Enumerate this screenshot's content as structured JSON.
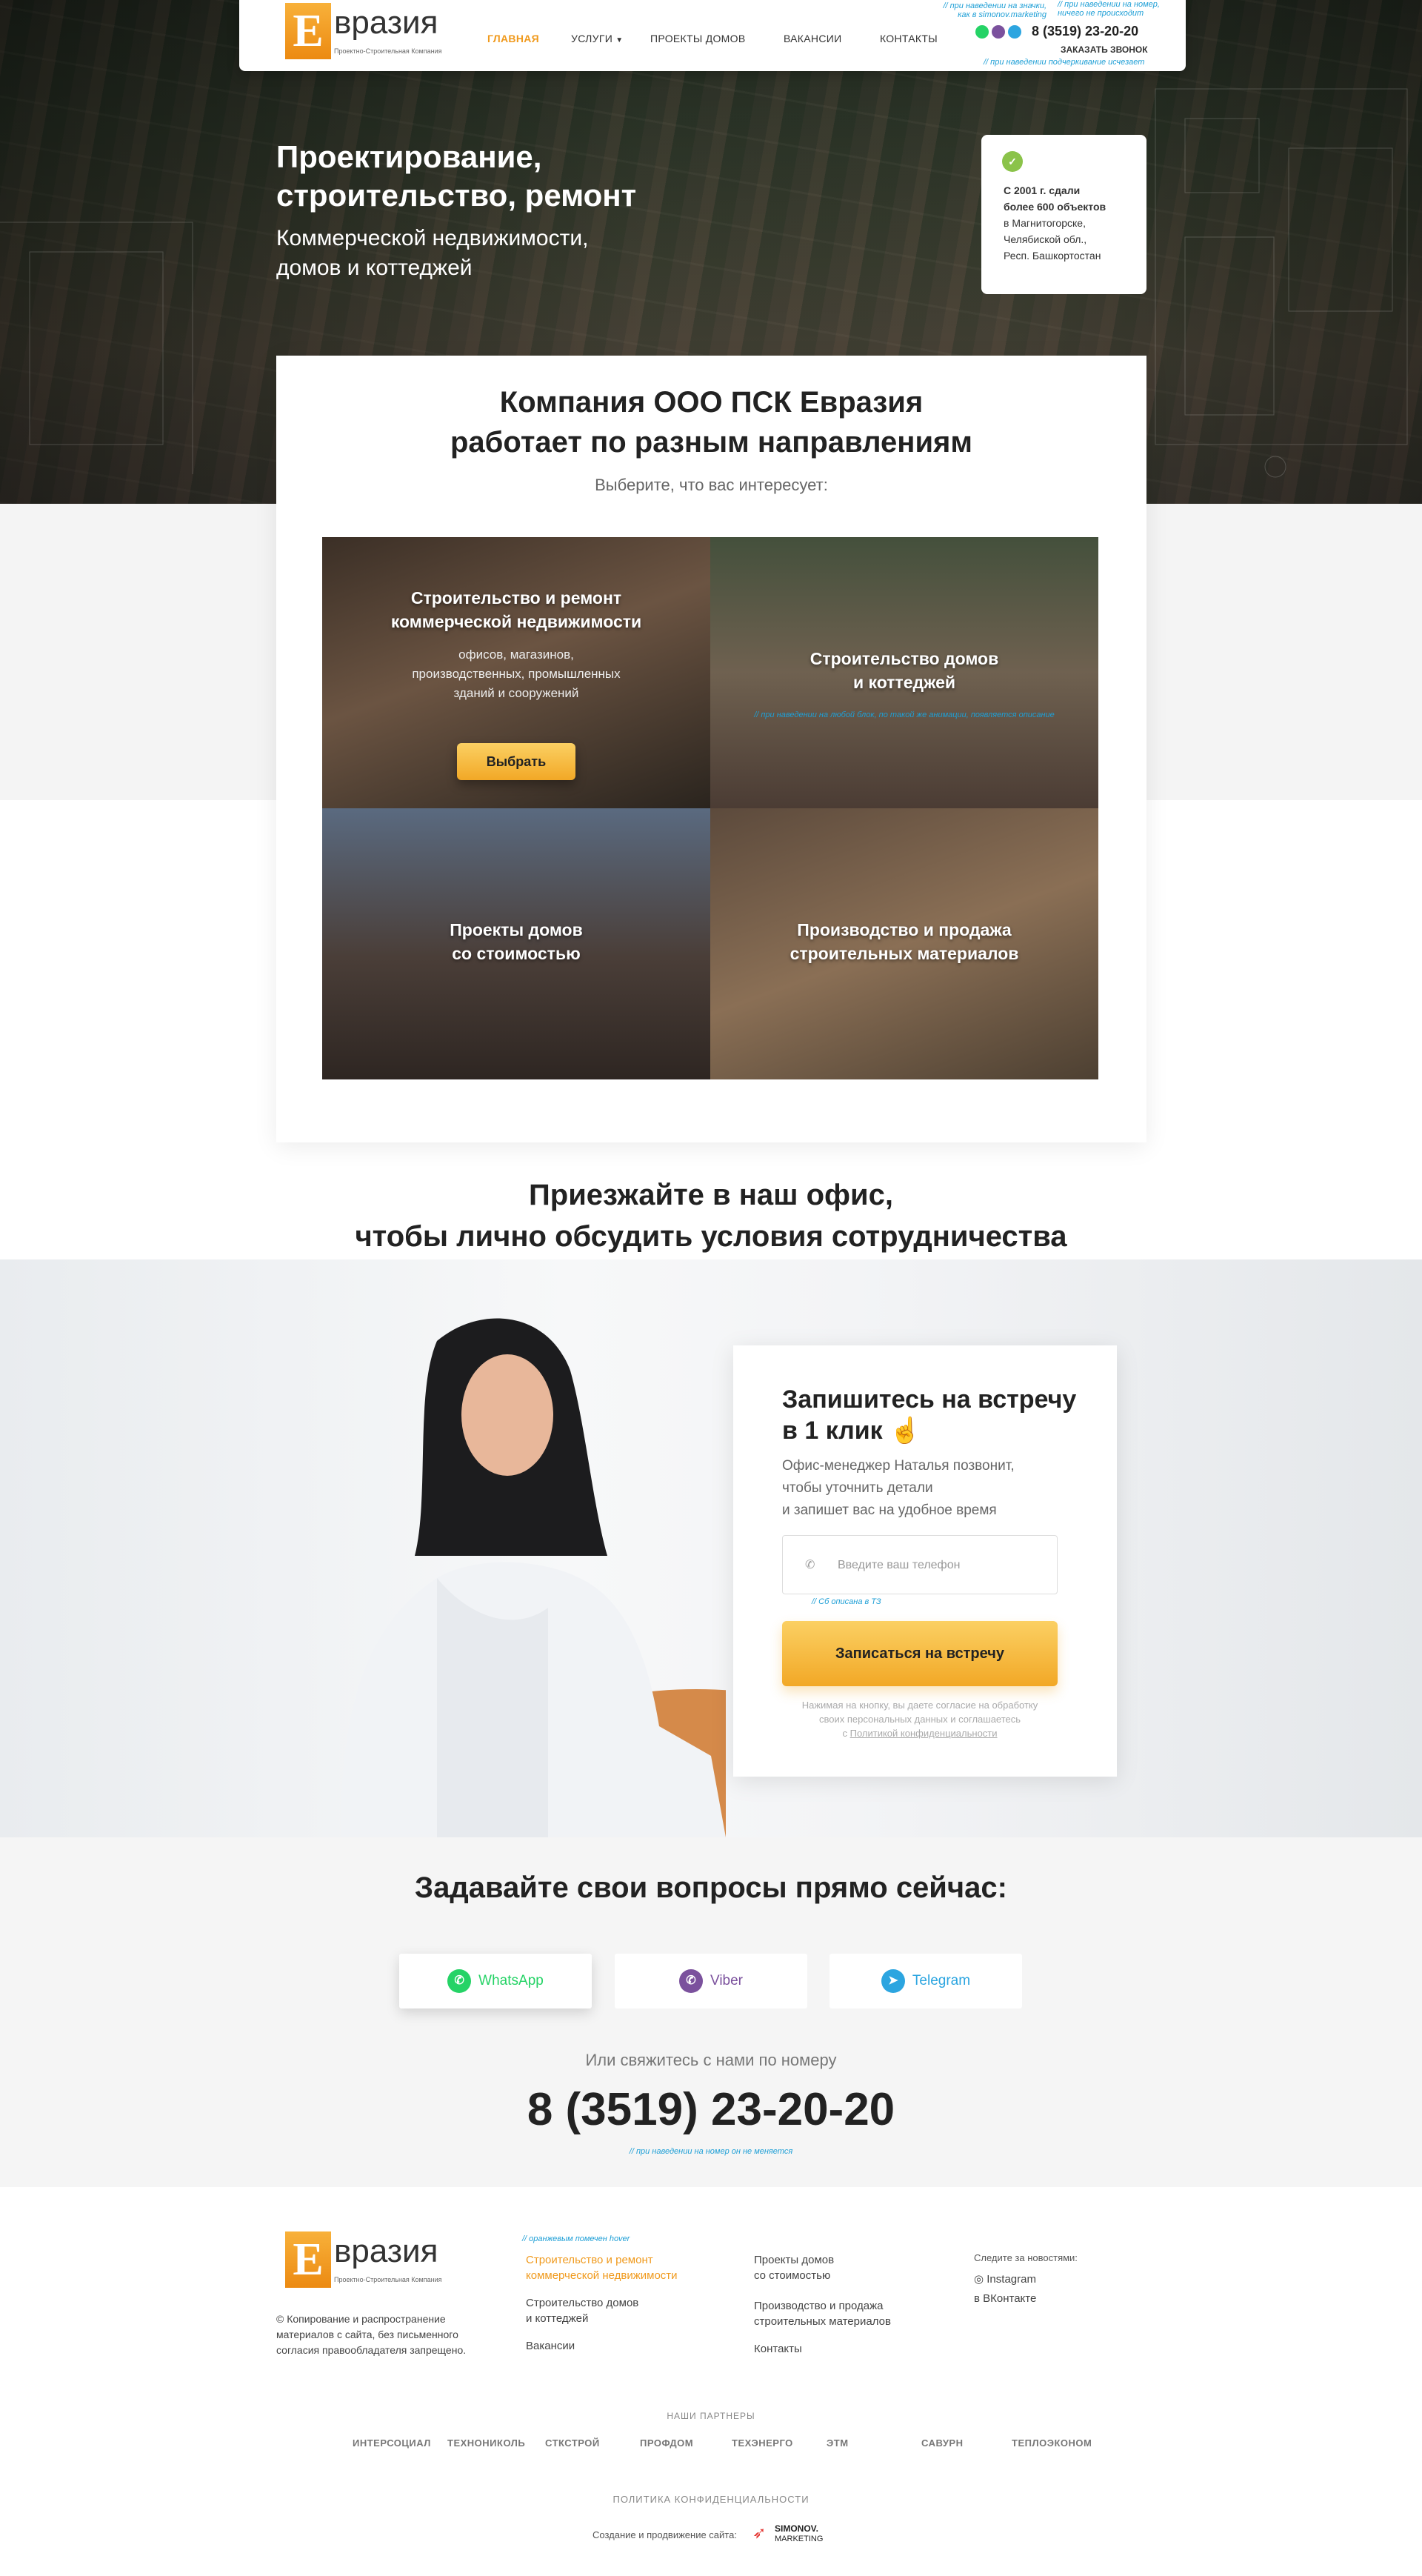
{
  "header": {
    "logo_letter": "Е",
    "logo_name": "вразия",
    "logo_sub": "Проектно-Строительная Компания",
    "nav": [
      "ГЛАВНАЯ",
      "УСЛУГИ",
      "ПРОЕКТЫ ДОМОВ",
      "ВАКАНСИИ",
      "КОНТАКТЫ"
    ],
    "note_icons": "// при наведении на значки,",
    "note_icons2": "как в simonov.marketing",
    "note_number": "// при наведении на номер,",
    "note_number2": "ничего не происходит",
    "phone": "8 (3519) 23-20-20",
    "callback": "ЗАКАЗАТЬ ЗВОНОК",
    "note_underline": "// при наведении подчеркивание исчезает"
  },
  "hero": {
    "title_line1": "Проектирование,",
    "title_line2": "строительство, ремонт",
    "sub_line1": "Коммерческой недвижимости,",
    "sub_line2": "домов и коттеджей",
    "badge_bold1": "С 2001 г. сдали",
    "badge_bold2": "более 600 объектов",
    "badge_l1": "в Магнитогорске,",
    "badge_l2": "Челябиской обл.,",
    "badge_l3": "Респ. Башкортостан"
  },
  "company": {
    "title_line1": "Компания ООО ПСК Евразия",
    "title_line2": "работает по разным направлениям",
    "choose": "Выберите, что вас интересует:",
    "tiles": [
      {
        "t1": "Строительство и ремонт",
        "t2": "коммерческой недвижимости",
        "d1": "офисов, магазинов,",
        "d2": "производственных, промышленных",
        "d3": "зданий и сооружений",
        "button": "Выбрать"
      },
      {
        "t1": "Строительство домов",
        "t2": "и коттеджей",
        "note": "// при наведении на любой блок, по такой же анимации, появляется описание"
      },
      {
        "t1": "Проекты домов",
        "t2": "со стоимостью"
      },
      {
        "t1": "Производство и продажа",
        "t2": "строительных материалов"
      }
    ]
  },
  "office": {
    "title_line1": "Приезжайте в наш офис,",
    "title_line2": "чтобы лично обсудить условия сотрудничества",
    "form_title1": "Запишитесь на встречу",
    "form_title2": "в 1 клик",
    "form_text1": "Офис-менеджер Наталья позвонит,",
    "form_text2": "чтобы уточнить детали",
    "form_text3": "и запишет вас на удобное время",
    "phone_placeholder": "Введите ваш телефон",
    "input_note": "// Cб описана в ТЗ",
    "submit": "Записаться на встречу",
    "consent1": "Нажимая на кнопку, вы даете согласие на обработку",
    "consent2": "своих персональных данных и соглашаетесь",
    "consent3_prefix": "с ",
    "consent3_link": "Политикой конфиденциальности"
  },
  "questions": {
    "title": "Задавайте свои вопросы прямо сейчас:",
    "buttons": [
      {
        "label": "WhatsApp",
        "color": "#25d366"
      },
      {
        "label": "Viber",
        "color": "#7b519d"
      },
      {
        "label": "Telegram",
        "color": "#2ca5e0"
      }
    ],
    "or_text": "Или свяжитесь с нами по номеру",
    "phone": "8 (3519) 23-20-20",
    "note": "// при наведении на номер он не меняется"
  },
  "footer": {
    "logo_letter": "Е",
    "logo_name": "вразия",
    "logo_sub": "Проектно-Строительная Компания",
    "copy1": "© Копирование и распространение",
    "copy2": "материалов с сайта, без письменного",
    "copy3": "согласия правообладателя запрещено.",
    "hover_note": "// оранжевым помечен hover",
    "col1": {
      "l1a": "Строительство и ремонт",
      "l1b": "коммерческой недвижимости",
      "l2a": "Строительство домов",
      "l2b": "и коттеджей",
      "l3": "Вакансии"
    },
    "col2": {
      "l1a": "Проекты домов",
      "l1b": "со стоимостью",
      "l2a": "Производство и продажа",
      "l2b": "строительных материалов",
      "l3": "Контакты"
    },
    "social_title": "Следите за новостями:",
    "instagram": "Instagram",
    "vk": "ВКонтакте",
    "partners_title": "НАШИ ПАРТНЕРЫ",
    "partners": [
      "ИНТЕРСОЦИАЛ",
      "ТЕХНОНИКОЛЬ",
      "СТКСТРОЙ",
      "ПРОФДОМ",
      "ТЕХЭНЕРГО",
      "ЭТМ",
      "САВУРН",
      "ТЕПЛОЭКОНОМ"
    ],
    "privacy": "ПОЛИТИКА КОНФИДЕНЦИАЛЬНОСТИ",
    "made_by": "Создание и продвижение сайта:",
    "made_by_brand1": "SIMONOV.",
    "made_by_brand2": "MARKETING"
  },
  "colors": {
    "accent": "#f09a1d",
    "note": "#1e9fd6",
    "button": "#f7bd43"
  }
}
